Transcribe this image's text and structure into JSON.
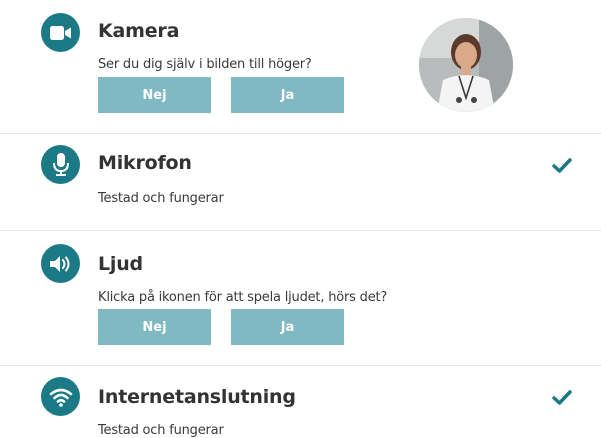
{
  "items": [
    {
      "title": "Kamera",
      "description": "Ser du dig själv i bilden till höger?",
      "icon": "camera-icon",
      "buttons": {
        "no": "Nej",
        "yes": "Ja"
      },
      "status": "pending"
    },
    {
      "title": "Mikrofon",
      "description": "Testad och fungerar",
      "icon": "microphone-icon",
      "status": "ok"
    },
    {
      "title": "Ljud",
      "description": "Klicka på ikonen för att spela ljudet, hörs det?",
      "icon": "speaker-icon",
      "buttons": {
        "no": "Nej",
        "yes": "Ja"
      },
      "status": "pending"
    },
    {
      "title": "Internetanslutning",
      "description": "Testad och fungerar",
      "icon": "wifi-icon",
      "status": "ok"
    }
  ],
  "colors": {
    "accent": "#1b7a86",
    "button": "#7fbac3",
    "check": "#1b7a86"
  }
}
